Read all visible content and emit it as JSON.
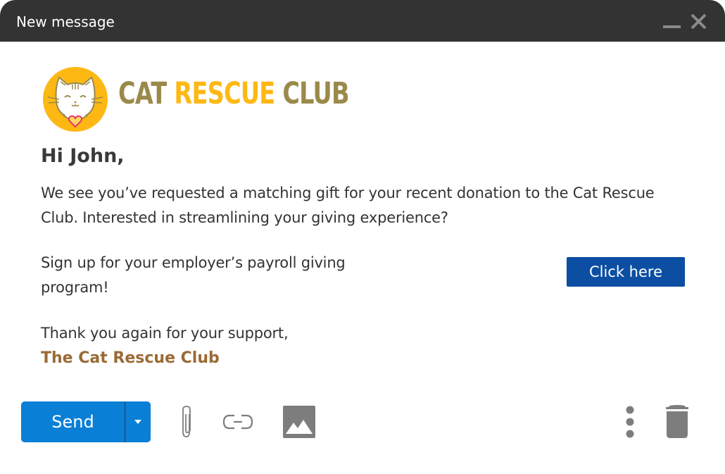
{
  "window": {
    "title": "New message",
    "minimize_icon": "minimize-icon",
    "close_icon": "close-icon"
  },
  "logo": {
    "icon": "cat-face-logo-icon",
    "word1": "CAT",
    "word2": "RESCUE",
    "word3": "CLUB",
    "colors": {
      "olive": "#9a8a4a",
      "yellow": "#fdb813",
      "heart": "#e8336d"
    }
  },
  "email": {
    "greeting": "Hi John,",
    "paragraph": "We see you’ve requested a matching gift for your recent donation to the Cat Rescue Club. Interested in streamlining your giving experience?",
    "signup_text": "Sign up for your employer’s payroll giving program!",
    "cta_label": "Click here",
    "thanks": "Thank you again for your support,",
    "signature": "The Cat Rescue Club"
  },
  "toolbar": {
    "send_label": "Send",
    "send_options_icon": "caret-down-icon",
    "attach_icon": "paperclip-icon",
    "link_icon": "link-icon",
    "image_icon": "image-icon",
    "more_icon": "more-vertical-icon",
    "delete_icon": "trash-icon"
  },
  "colors": {
    "titlebar": "#333333",
    "send_button": "#0a7fd6",
    "cta_button": "#0b4ea2",
    "icon_gray": "#7d7d7d"
  }
}
